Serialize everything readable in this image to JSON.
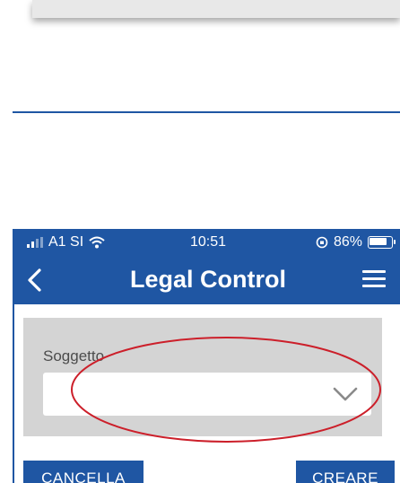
{
  "status_bar": {
    "carrier": "A1 SI",
    "time": "10:51",
    "battery_percent": "86%",
    "battery_level": 0.86
  },
  "nav": {
    "title": "Legal Control",
    "back_icon": "chevron-left-icon",
    "menu_icon": "hamburger-menu-icon"
  },
  "form": {
    "field_label": "Soggetto",
    "field_value": "",
    "dropdown_icon": "chevron-down-icon"
  },
  "actions": {
    "cancel_label": "CANCELLA",
    "create_label": "CREARE"
  },
  "colors": {
    "brand_blue": "#1f56a3",
    "card_gray": "#d4d4d4",
    "annotation_red": "#cc1f2a"
  }
}
